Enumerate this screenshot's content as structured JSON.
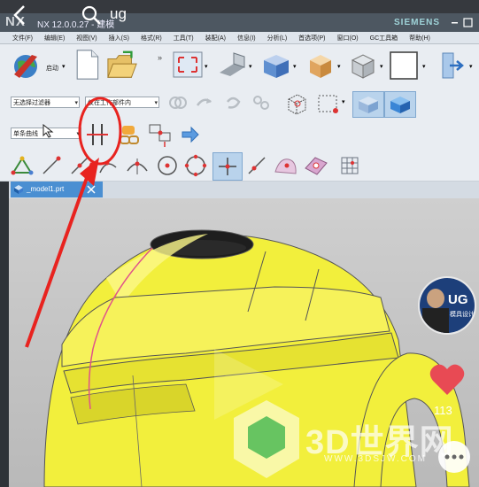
{
  "video_overlay": {
    "search_text": "ug"
  },
  "window": {
    "logo": "NX",
    "title": "NX 12.0.0.27 - 建模",
    "brand": "SIEMENS"
  },
  "menu": [
    "文件(F)",
    "编辑(E)",
    "视图(V)",
    "插入(S)",
    "格式(R)",
    "工具(T)",
    "装配(A)",
    "信息(I)",
    "分析(L)",
    "首选项(P)",
    "窗口(O)",
    "GC工具箱",
    "帮助(H)"
  ],
  "toolbar1": {
    "start_label": "启动"
  },
  "toolbar2": {
    "filter_value": "无选择过滤器",
    "scope_value": "仅在工作部件内"
  },
  "toolbar3": {
    "curve_rule_value": "单条曲线"
  },
  "tab": {
    "label": "_model1.prt"
  },
  "social": {
    "like_count": "113",
    "host_badge": "UG",
    "host_sub": "模具设计"
  },
  "watermark": {
    "brand": "3D世界网",
    "url": "WWW.3DSJW.COM"
  },
  "colors": {
    "model": "#f2ef3c",
    "annotation": "#e8231f",
    "tab": "#4a8fd2",
    "titlebar": "#4d5761"
  }
}
